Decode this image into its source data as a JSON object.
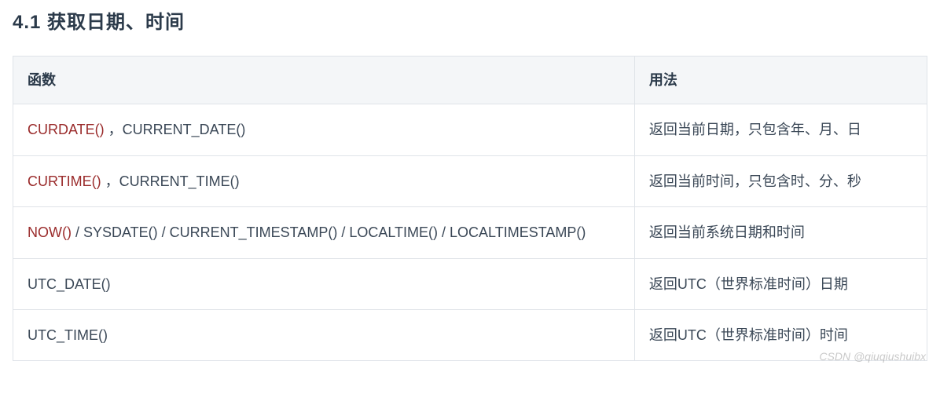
{
  "heading": "4.1 获取日期、时间",
  "table": {
    "headers": {
      "func": "函数",
      "usage": "用法"
    },
    "rows": [
      {
        "func_red": "CURDATE()",
        "func_tail": " ，CURRENT_DATE()",
        "usage": "返回当前日期，只包含年、月、日"
      },
      {
        "func_red": "CURTIME()",
        "func_tail": " ，CURRENT_TIME()",
        "usage": "返回当前时间，只包含时、分、秒"
      },
      {
        "func_red": "NOW()",
        "func_tail": " / SYSDATE() / CURRENT_TIMESTAMP() / LOCALTIME() / LOCALTIMESTAMP()",
        "usage": "返回当前系统日期和时间"
      },
      {
        "func_red": "",
        "func_tail": "UTC_DATE()",
        "usage": "返回UTC（世界标准时间）日期"
      },
      {
        "func_red": "",
        "func_tail": "UTC_TIME()",
        "usage": "返回UTC（世界标准时间）时间"
      }
    ]
  },
  "watermark": "CSDN @qiuqiushuibx"
}
